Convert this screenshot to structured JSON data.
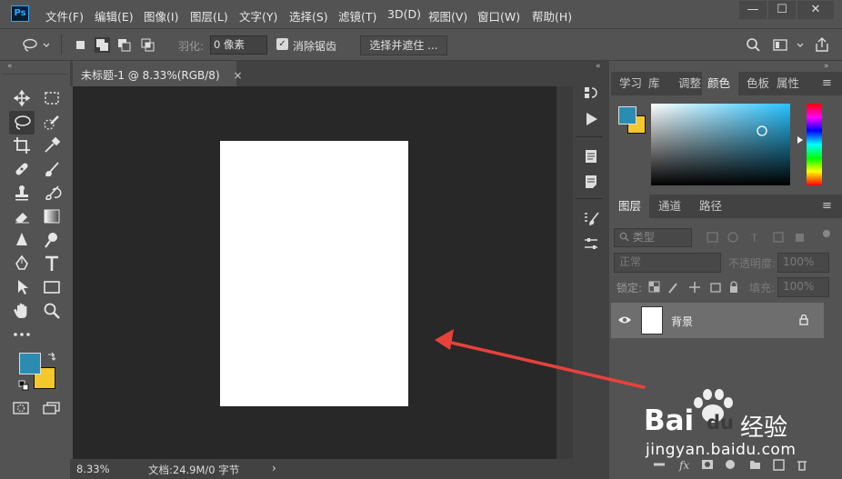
{
  "app": {
    "logo": "Ps"
  },
  "menu": [
    "文件(F)",
    "编辑(E)",
    "图像(I)",
    "图层(L)",
    "文字(Y)",
    "选择(S)",
    "滤镜(T)",
    "3D(D)",
    "视图(V)",
    "窗口(W)",
    "帮助(H)"
  ],
  "window_controls": {
    "minimize": "—",
    "maximize": "☐",
    "close": "✕"
  },
  "options": {
    "feather_label": "羽化:",
    "feather_value": "0 像素",
    "antialias_label": "消除锯齿",
    "antialias_checked": true,
    "select_mask_label": "选择并遮住 ..."
  },
  "document": {
    "tab_title": "未标题-1 @ 8.33%(RGB/8)",
    "tab_close": "×",
    "zoom": "8.33%",
    "doc_info": "文档:24.9M/0 字节",
    "status_arrow": "›"
  },
  "tools": [
    "move-tool",
    "marquee-tool",
    "lasso-tool",
    "quick-select-tool",
    "crop-tool",
    "eyedropper-tool",
    "healing-tool",
    "brush-tool",
    "stamp-tool",
    "history-brush-tool",
    "eraser-tool",
    "gradient-tool",
    "blur-tool",
    "dodge-tool",
    "pen-tool",
    "type-tool",
    "path-select-tool",
    "shape-tool",
    "hand-tool",
    "zoom-tool",
    "more-tools"
  ],
  "colors": {
    "foreground": "#2b8cb1",
    "background": "#f4c82c",
    "picker_hue": "#27c2ff"
  },
  "color_panel": {
    "tabs": [
      "学习",
      "库",
      "调整",
      "颜色",
      "色板",
      "属性"
    ],
    "active_tab": "颜色"
  },
  "layers_panel": {
    "tabs": [
      "图层",
      "通道",
      "路径"
    ],
    "active_tab": "图层",
    "filter_label": "类型",
    "blend_mode": "正常",
    "opacity_label": "不透明度:",
    "opacity_value": "100%",
    "lock_label": "锁定:",
    "fill_label": "填充:",
    "fill_value": "100%",
    "layers": [
      {
        "name": "背景",
        "visible": true,
        "locked": true
      }
    ]
  },
  "watermark": {
    "brand": "Bai",
    "brand2": "du",
    "cn": "经验",
    "url": "jingyan.baidu.com"
  },
  "annotation": {
    "color": "#e8413c"
  }
}
